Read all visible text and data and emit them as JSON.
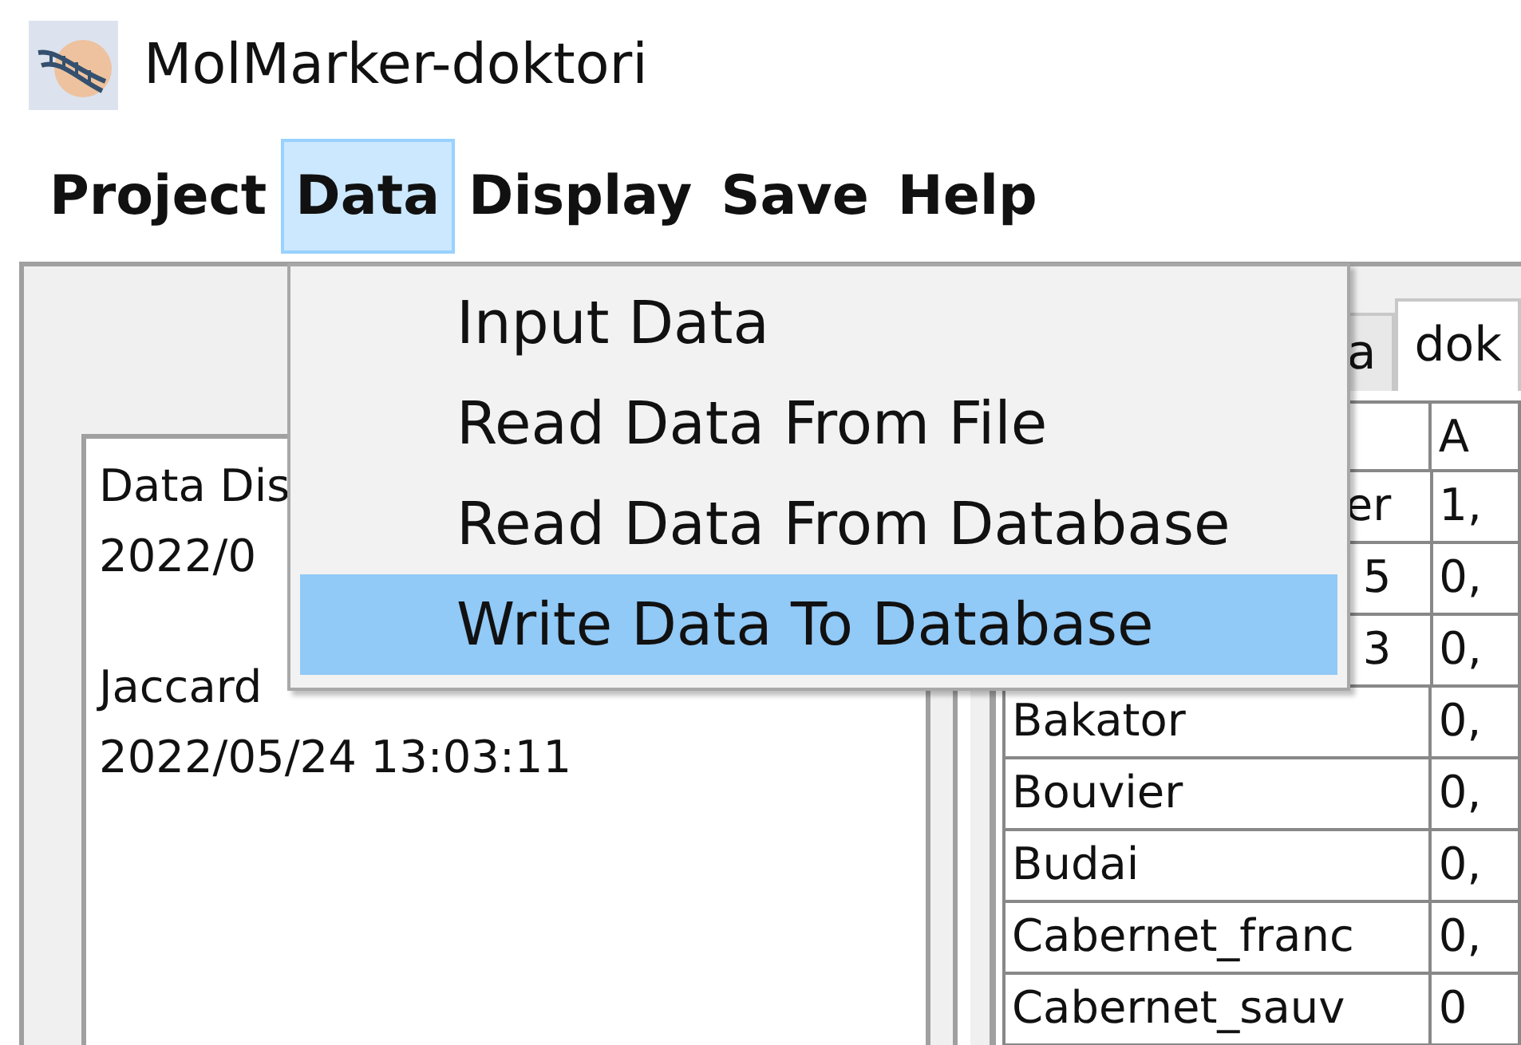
{
  "window": {
    "title": "MolMarker-doktori"
  },
  "menu_bar": [
    {
      "label": "Project",
      "selected": false
    },
    {
      "label": "Data",
      "selected": true
    },
    {
      "label": "Display",
      "selected": false
    },
    {
      "label": "Save",
      "selected": false
    },
    {
      "label": "Help",
      "selected": false
    }
  ],
  "dropdown_menu": [
    {
      "label": "Input Data",
      "selected": false
    },
    {
      "label": "Read Data From File",
      "selected": false
    },
    {
      "label": "Read Data From Database",
      "selected": false
    },
    {
      "label": "Write Data To Database",
      "selected": true
    }
  ],
  "log_text": [
    [
      "Data Dis",
      "2022/0"
    ],
    [
      "Jaccard",
      "2022/05/24 13:03:11"
    ]
  ],
  "tabs": [
    {
      "label": "a",
      "selected": false
    },
    {
      "label": "dok",
      "selected": true
    }
  ],
  "table": {
    "columns": [
      "",
      "A"
    ],
    "rows": [
      {
        "cells": [
          "er",
          "1,"
        ],
        "partial": true
      },
      {
        "cells": [
          "5",
          "0,"
        ],
        "partial": true
      },
      {
        "cells": [
          "3",
          "0,"
        ],
        "partial": true
      },
      {
        "cells": [
          "Bakator",
          "0,"
        ],
        "partial": false
      },
      {
        "cells": [
          "Bouvier",
          "0,"
        ],
        "partial": false
      },
      {
        "cells": [
          "Budai",
          "0,"
        ],
        "partial": false
      },
      {
        "cells": [
          "Cabernet_franc",
          "0,"
        ],
        "partial": false
      },
      {
        "cells": [
          "Cabernet_sauv",
          "0"
        ],
        "partial": false
      }
    ]
  }
}
